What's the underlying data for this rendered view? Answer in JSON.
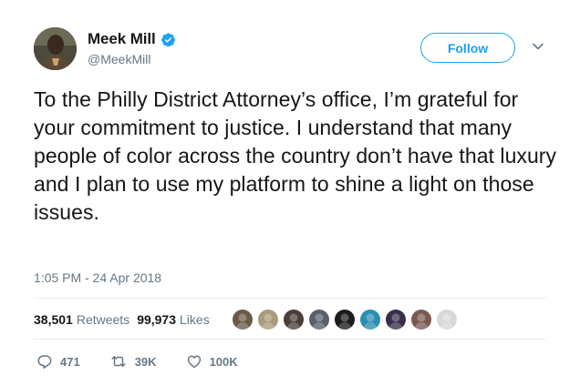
{
  "user": {
    "display_name": "Meek Mill",
    "handle": "@MeekMill",
    "verified_icon": "verified-badge-icon",
    "verified_color": "#1da1f2"
  },
  "follow_button": {
    "label": "Follow"
  },
  "tweet": {
    "text": "To the Philly District Attorney’s office, I’m grateful for your commitment to justice. I understand that many people of color across the country don’t have that luxury and I plan to use my platform to shine a light on those issues.",
    "timestamp": "1:05 PM - 24 Apr 2018"
  },
  "stats": {
    "retweets_count": "38,501",
    "retweets_label": "Retweets",
    "likes_count": "99,973",
    "likes_label": "Likes"
  },
  "likers": [
    {
      "color": "#6b5a48"
    },
    {
      "color": "#a89a7a"
    },
    {
      "color": "#4a3f38"
    },
    {
      "color": "#5a5f6a"
    },
    {
      "color": "#1c1c1c"
    },
    {
      "color": "#2a8fb0"
    },
    {
      "color": "#3a2f4a"
    },
    {
      "color": "#7a5a50"
    },
    {
      "color": "#d8d8d8"
    }
  ],
  "actions": {
    "replies": "471",
    "retweets": "39K",
    "likes": "100K"
  },
  "colors": {
    "accent": "#1da1f2",
    "secondary_text": "#657786",
    "divider": "#e6ecf0"
  }
}
